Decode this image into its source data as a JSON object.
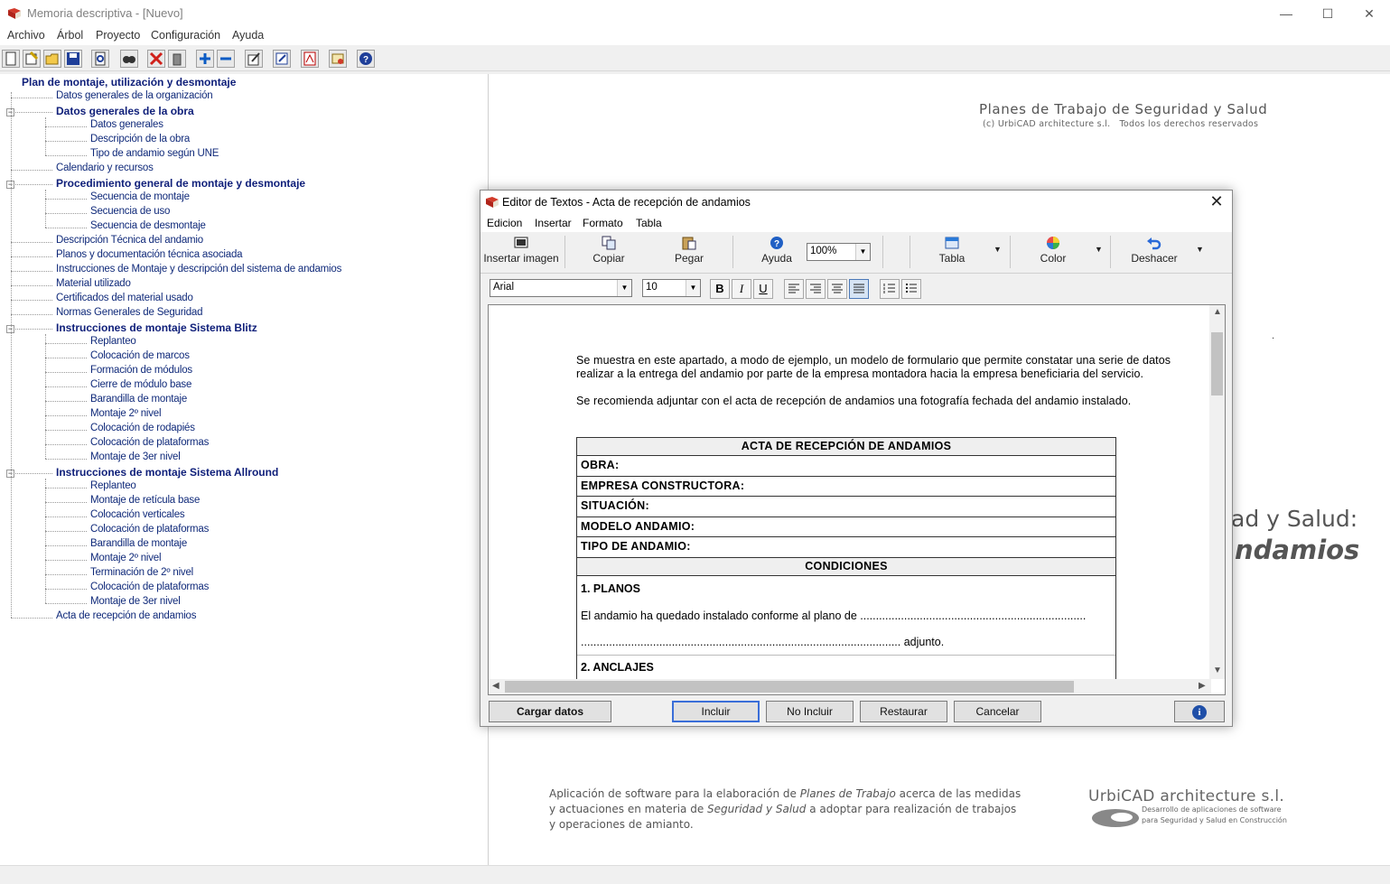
{
  "window": {
    "title": "Memoria descriptiva - [Nuevo]",
    "controls": {
      "minimize": "—",
      "maximize": "☐",
      "close": "✕"
    }
  },
  "menu": [
    "Archivo",
    "Árbol",
    "Proyecto",
    "Configuración",
    "Ayuda"
  ],
  "toolbar_icons": [
    "new-document-icon",
    "wizard-icon",
    "open-folder-icon",
    "save-icon",
    "preview-icon",
    "find-icon",
    "delete-icon",
    "trash-icon",
    "expand-icon",
    "collapse-icon",
    "edit-icon",
    "notepad-icon",
    "pdf-icon",
    "certificate-icon",
    "help-icon"
  ],
  "tree": {
    "root": "Plan de montaje, utilización y desmontaje",
    "items": [
      {
        "label": "Datos generales de la organización",
        "level": 1,
        "bold": false
      },
      {
        "label": "Datos generales de la obra",
        "level": 1,
        "bold": true,
        "expanded": true
      },
      {
        "label": "Datos generales",
        "level": 2,
        "bold": false
      },
      {
        "label": "Descripción de la obra",
        "level": 2,
        "bold": false
      },
      {
        "label": "Tipo de andamio según UNE",
        "level": 2,
        "bold": false
      },
      {
        "label": "Calendario y recursos",
        "level": 1,
        "bold": false
      },
      {
        "label": "Procedimiento general de montaje y desmontaje",
        "level": 1,
        "bold": true,
        "expanded": true
      },
      {
        "label": "Secuencia de montaje",
        "level": 2,
        "bold": false
      },
      {
        "label": "Secuencia de uso",
        "level": 2,
        "bold": false
      },
      {
        "label": "Secuencia de desmontaje",
        "level": 2,
        "bold": false
      },
      {
        "label": "Descripción Técnica del andamio",
        "level": 1,
        "bold": false
      },
      {
        "label": "Planos y documentación técnica asociada",
        "level": 1,
        "bold": false
      },
      {
        "label": "Instrucciones de Montaje y descripción del sistema de andamios",
        "level": 1,
        "bold": false
      },
      {
        "label": "Material utilizado",
        "level": 1,
        "bold": false
      },
      {
        "label": "Certificados del material usado",
        "level": 1,
        "bold": false
      },
      {
        "label": "Normas Generales de Seguridad",
        "level": 1,
        "bold": false
      },
      {
        "label": "Instrucciones de montaje Sistema Blitz",
        "level": 1,
        "bold": true,
        "expanded": true
      },
      {
        "label": "Replanteo",
        "level": 2,
        "bold": false
      },
      {
        "label": "Colocación de marcos",
        "level": 2,
        "bold": false
      },
      {
        "label": "Formación de módulos",
        "level": 2,
        "bold": false
      },
      {
        "label": "Cierre de módulo base",
        "level": 2,
        "bold": false
      },
      {
        "label": "Barandilla de montaje",
        "level": 2,
        "bold": false
      },
      {
        "label": "Montaje 2º nivel",
        "level": 2,
        "bold": false
      },
      {
        "label": "Colocación de rodapiés",
        "level": 2,
        "bold": false
      },
      {
        "label": "Colocación de plataformas",
        "level": 2,
        "bold": false
      },
      {
        "label": "Montaje de 3er nivel",
        "level": 2,
        "bold": false
      },
      {
        "label": "Instrucciones de montaje Sistema Allround",
        "level": 1,
        "bold": true,
        "expanded": true
      },
      {
        "label": "Replanteo",
        "level": 2,
        "bold": false
      },
      {
        "label": "Montaje de retícula base",
        "level": 2,
        "bold": false
      },
      {
        "label": "Colocación verticales",
        "level": 2,
        "bold": false
      },
      {
        "label": "Colocación de plataformas",
        "level": 2,
        "bold": false
      },
      {
        "label": "Barandilla de montaje",
        "level": 2,
        "bold": false
      },
      {
        "label": "Montaje 2º nivel",
        "level": 2,
        "bold": false
      },
      {
        "label": "Terminación de 2º nivel",
        "level": 2,
        "bold": false
      },
      {
        "label": "Colocación de plataformas",
        "level": 2,
        "bold": false
      },
      {
        "label": "Montaje de 3er nivel",
        "level": 2,
        "bold": false
      },
      {
        "label": "Acta de recepción de andamios",
        "level": 1,
        "bold": false
      }
    ]
  },
  "background": {
    "heading": "Planes de Trabajo de Seguridad y Salud",
    "copyright": "(c) UrbiCAD architecture s.l.   Todos los derechos reservados",
    "dot": ".",
    "partial_line1": "ad y Salud:",
    "partial_line2": "ndamios",
    "footer_line1_a": "Aplicación de software para la elaboración de ",
    "footer_line1_em": "Planes de Trabajo",
    "footer_line1_b": " acerca de las medidas",
    "footer_line2_a": "y actuaciones en materia de ",
    "footer_line2_em": "Seguridad y Salud",
    "footer_line2_b": " a adoptar para realización de trabajos",
    "footer_line3": "y operaciones de amianto.",
    "brand": "UrbiCAD architecture s.l.",
    "brand_sub1": "Desarrollo de aplicaciones de software",
    "brand_sub2": "para Seguridad y Salud en Construcción"
  },
  "dialog": {
    "title": "Editor de Textos - Acta de recepción de andamios",
    "close": "✕",
    "menu": [
      "Edicion",
      "Insertar",
      "Formato",
      "Tabla"
    ],
    "ribbon": {
      "insert_image": "Insertar imagen",
      "copy": "Copiar",
      "paste": "Pegar",
      "help": "Ayuda",
      "zoom": "100%",
      "table": "Tabla",
      "color": "Color",
      "undo": "Deshacer"
    },
    "format": {
      "font": "Arial",
      "size": "10",
      "bold": "B",
      "italic": "I",
      "underline": "U"
    },
    "content": {
      "para1_line1": "Se muestra en este apartado, a modo de ejemplo, un modelo de formulario que permite constatar una serie de datos",
      "para1_line2": "realizar a la entrega del andamio por parte de la empresa montadora hacia la empresa beneficiaria del servicio.",
      "para2": "Se recomienda adjuntar con el acta de recepción de andamios una fotografía fechada del andamio instalado.",
      "table_title": "ACTA DE RECEPCIÓN DE ANDAMIOS",
      "rows": [
        "OBRA:",
        "EMPRESA CONSTRUCTORA:",
        "SITUACIÓN:",
        "MODELO ANDAMIO:",
        "TIPO DE ANDAMIO:"
      ],
      "conditions": "CONDICIONES",
      "planos_title": "1. PLANOS",
      "planos_line1": "El andamio ha quedado instalado conforme al plano de ........................................................................",
      "planos_line2": "...................................................................................................... adjunto.",
      "anclajes_title": "2. ANCLAJES"
    },
    "buttons": {
      "load": "Cargar datos",
      "include": "Incluir",
      "exclude": "No Incluir",
      "restore": "Restaurar",
      "cancel": "Cancelar",
      "info": "i"
    }
  },
  "colors": {
    "tree_text": "#102a7a",
    "accent": "#0a5bc4"
  }
}
